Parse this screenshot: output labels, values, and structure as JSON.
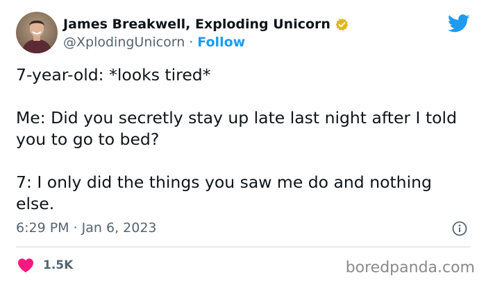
{
  "author": {
    "display_name": "James Breakwell, Exploding Unicorn",
    "handle": "@XplodingUnicorn",
    "separator": "·",
    "follow_label": "Follow",
    "verified": true
  },
  "tweet": {
    "paragraphs": [
      "7-year-old: *looks tired*",
      "Me: Did you secretly stay up late last night after I told you to go to bed?",
      "7: I only did the things you saw me do and nothing else."
    ],
    "timestamp": "6:29 PM · Jan 6, 2023"
  },
  "engagement": {
    "like_count": "1.5K"
  },
  "watermark": "boredpanda.com",
  "colors": {
    "accent_blue": "#1d9bf0",
    "verified_gold": "#e2b719",
    "heart_pink": "#f91880",
    "secondary_text": "#536471",
    "primary_text": "#0f1419"
  },
  "icons": {
    "logo": "twitter-bird-icon",
    "verified": "verified-badge-icon",
    "info": "info-icon",
    "like": "heart-icon"
  }
}
